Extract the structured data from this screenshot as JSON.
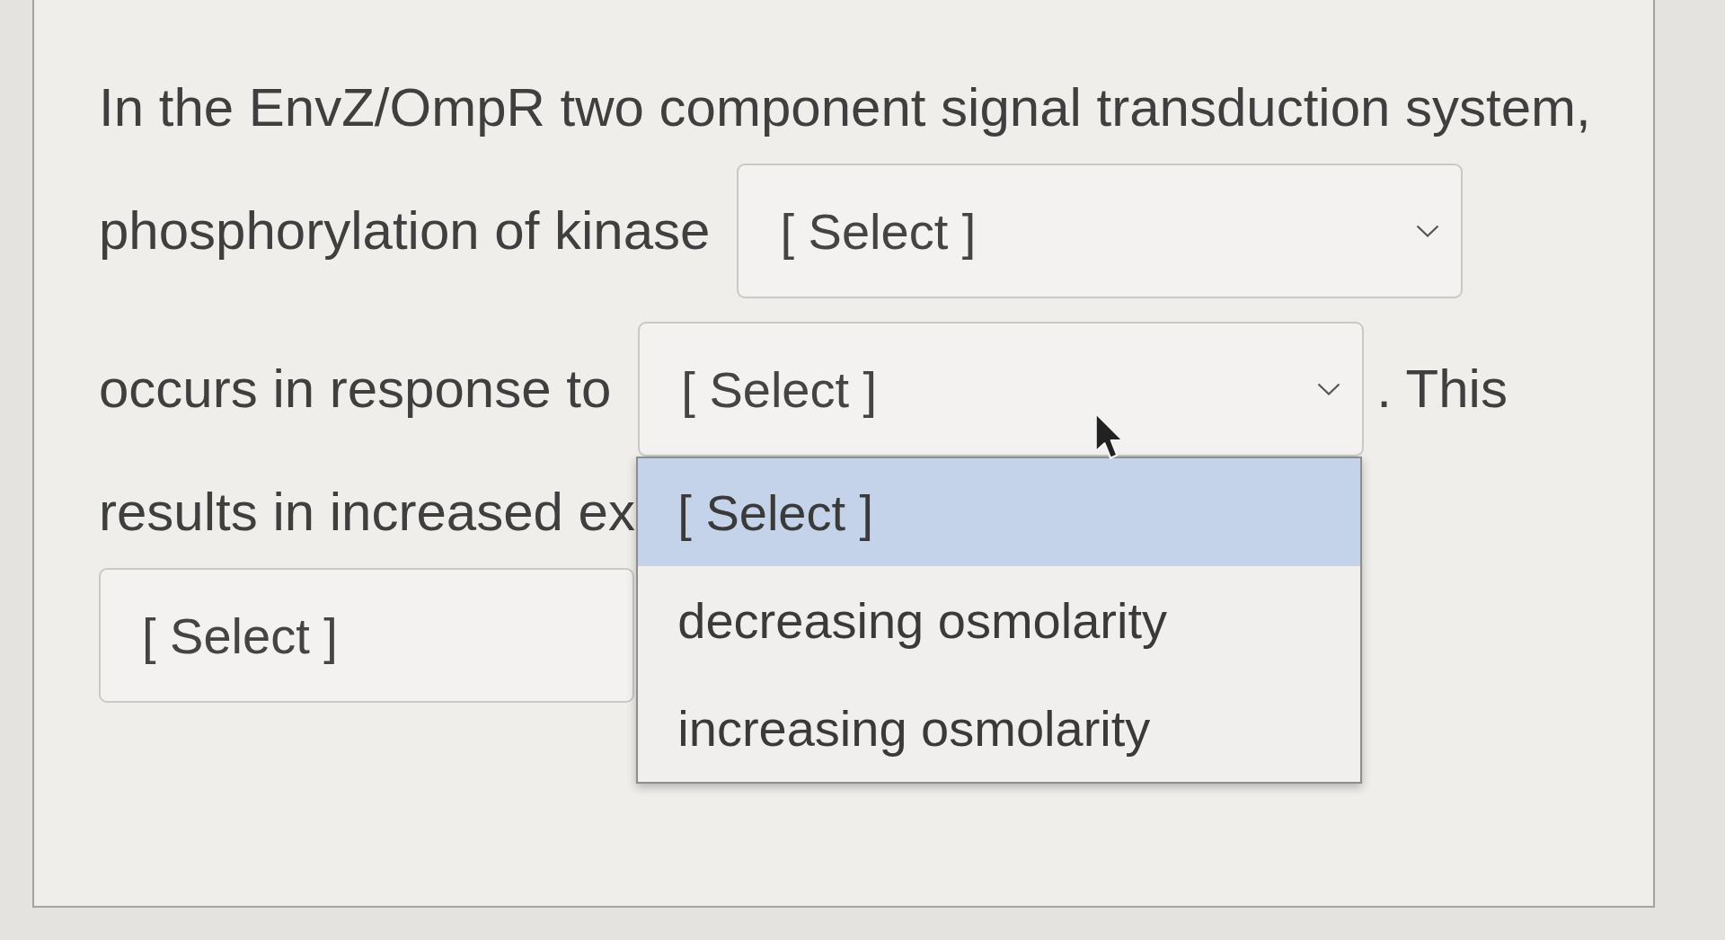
{
  "question": {
    "lines": [
      [
        {
          "kind": "text",
          "text": "In the EnvZ/OmpR two component signal transduction system,"
        }
      ],
      [
        {
          "kind": "text",
          "text": "phosphorylation of kinase"
        },
        {
          "kind": "select",
          "value": "[ Select ]",
          "caret": true,
          "expanded": false
        }
      ],
      [
        {
          "kind": "text",
          "text": "occurs in response to"
        },
        {
          "kind": "select",
          "value": "[ Select ]",
          "caret": true,
          "expanded": true,
          "options": [
            {
              "label": "[ Select ]",
              "selected": true
            },
            {
              "label": "decreasing osmolarity",
              "selected": false
            },
            {
              "label": "increasing osmolarity",
              "selected": false
            }
          ]
        },
        {
          "kind": "text",
          "text": ". This"
        }
      ],
      [
        {
          "kind": "text",
          "text": "results in increased ex"
        }
      ],
      [
        {
          "kind": "select",
          "value": "[ Select ]",
          "caret": false,
          "expanded": false
        }
      ]
    ]
  }
}
